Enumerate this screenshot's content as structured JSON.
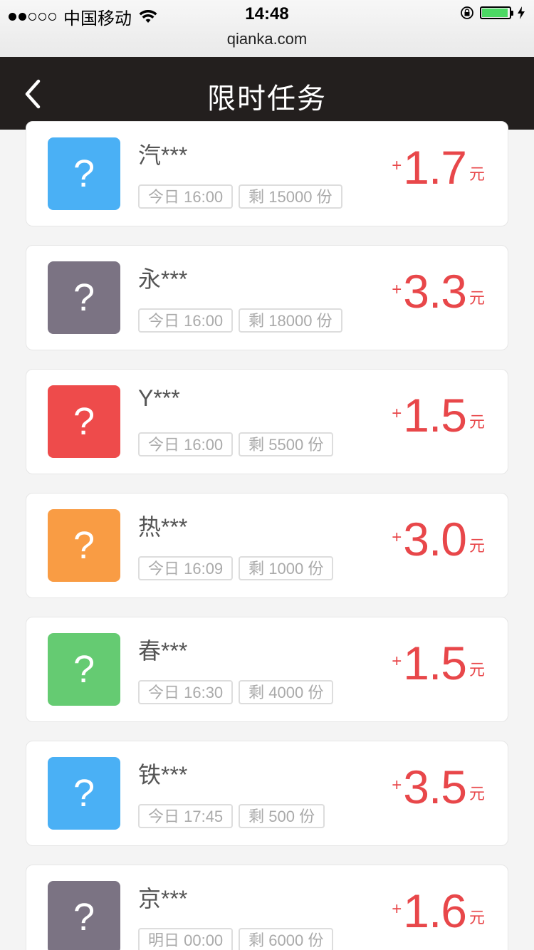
{
  "status_bar": {
    "carrier": "中国移动",
    "time": "14:48",
    "url": "qianka.com",
    "signal_bars_filled": 2,
    "signal_bars_total": 5,
    "battery_level": 0.95
  },
  "header": {
    "title": "限时任务",
    "back_icon": "chevron-left-icon"
  },
  "colors": {
    "nav_bg": "#231f1e",
    "reward_red": "#e8474a",
    "blue": "#4ab0f5",
    "gray": "#7b7383",
    "red": "#ee4b4b",
    "orange": "#f99c44",
    "green": "#65cb72"
  },
  "tasks": [
    {
      "icon": "?",
      "color": "#4ab0f5",
      "name": "汽***",
      "time": "今日 16:00",
      "remaining": "剩 15000 份",
      "plus": "+",
      "amount": "1.7",
      "unit": "元"
    },
    {
      "icon": "?",
      "color": "#7b7383",
      "name": "永***",
      "time": "今日 16:00",
      "remaining": "剩 18000 份",
      "plus": "+",
      "amount": "3.3",
      "unit": "元"
    },
    {
      "icon": "?",
      "color": "#ee4b4b",
      "name": "Y***",
      "time": "今日 16:00",
      "remaining": "剩 5500 份",
      "plus": "+",
      "amount": "1.5",
      "unit": "元"
    },
    {
      "icon": "?",
      "color": "#f99c44",
      "name": "热***",
      "time": "今日 16:09",
      "remaining": "剩 1000 份",
      "plus": "+",
      "amount": "3.0",
      "unit": "元"
    },
    {
      "icon": "?",
      "color": "#65cb72",
      "name": "春***",
      "time": "今日 16:30",
      "remaining": "剩 4000 份",
      "plus": "+",
      "amount": "1.5",
      "unit": "元"
    },
    {
      "icon": "?",
      "color": "#4ab0f5",
      "name": "铁***",
      "time": "今日 17:45",
      "remaining": "剩 500 份",
      "plus": "+",
      "amount": "3.5",
      "unit": "元"
    },
    {
      "icon": "?",
      "color": "#7b7383",
      "name": "京***",
      "time": "明日 00:00",
      "remaining": "剩 6000 份",
      "plus": "+",
      "amount": "1.6",
      "unit": "元"
    }
  ]
}
